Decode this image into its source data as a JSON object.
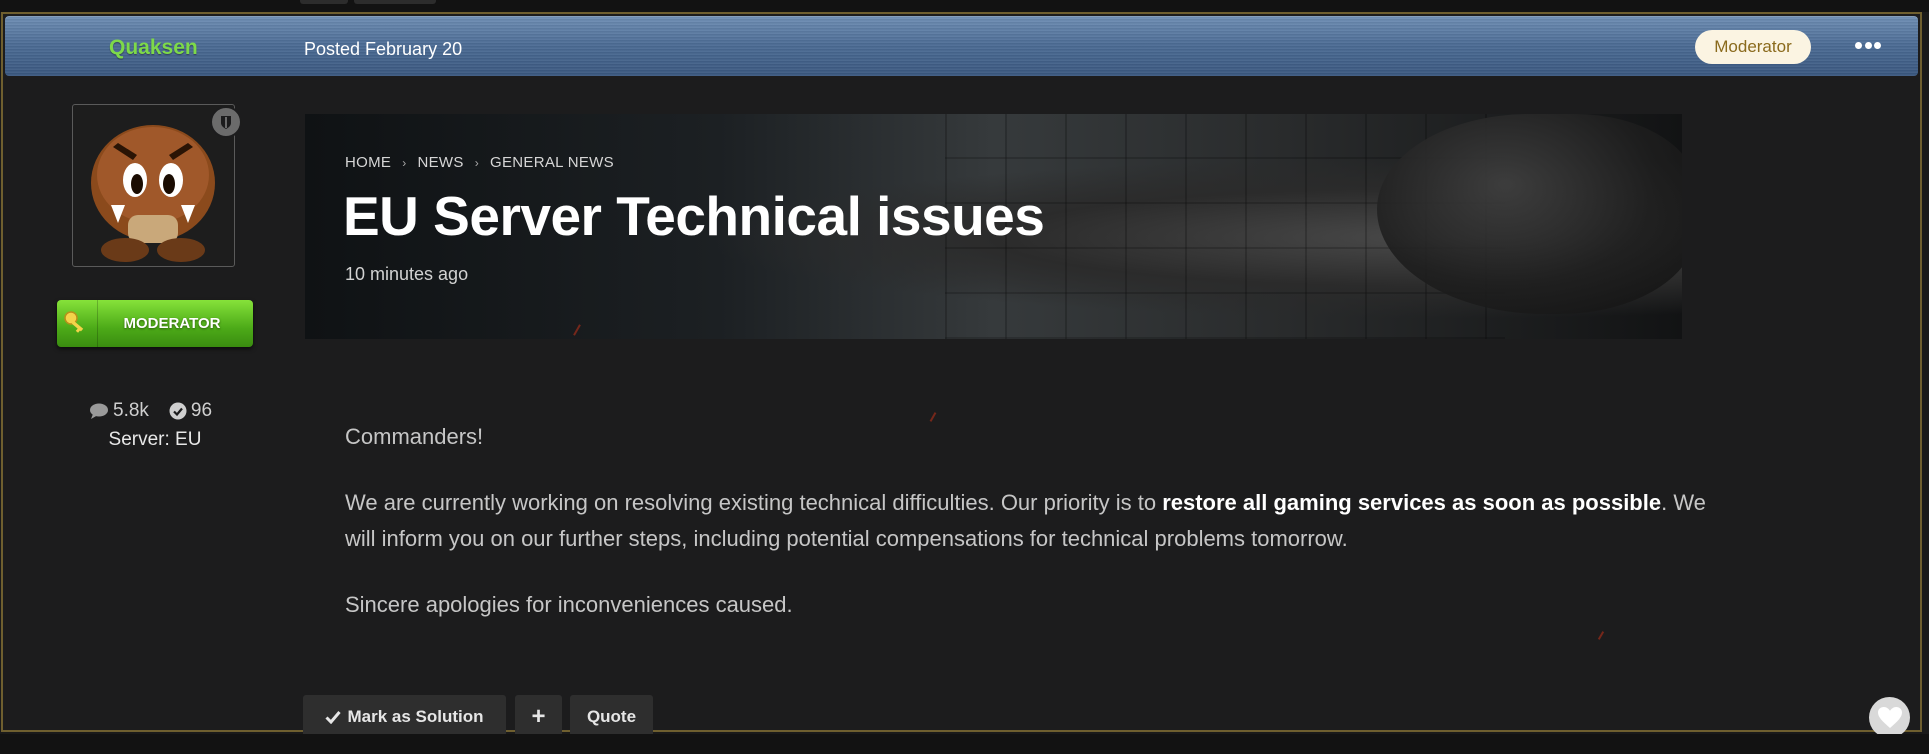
{
  "post": {
    "author": "Quaksen",
    "posted": "Posted February 20",
    "role_pill": "Moderator",
    "menu_icon": "ellipsis-icon"
  },
  "author_panel": {
    "badge_label": "MODERATOR",
    "posts_count": "5.8k",
    "solutions_count": "96",
    "server": "Server: EU"
  },
  "banner": {
    "breadcrumb": [
      "HOME",
      "NEWS",
      "GENERAL NEWS"
    ],
    "title": "EU Server Technical issues",
    "time": "10 minutes ago"
  },
  "content": {
    "greeting": "Commanders!",
    "p1_before": "We are currently working on resolving existing technical difficulties. Our priority is to ",
    "p1_bold": "restore all gaming services as soon as possible",
    "p1_after": ". We will inform you on our further steps, including potential compensations for technical problems tomorrow.",
    "closing": "Sincere apologies for inconveniences caused."
  },
  "actions": {
    "mark_solution": "Mark as Solution",
    "add": "+",
    "quote": "Quote"
  },
  "colors": {
    "username": "#7dd94a",
    "header_blue": "#4c6c95",
    "badge_green": "#4caa18",
    "border_gold": "#6f5f2f"
  }
}
